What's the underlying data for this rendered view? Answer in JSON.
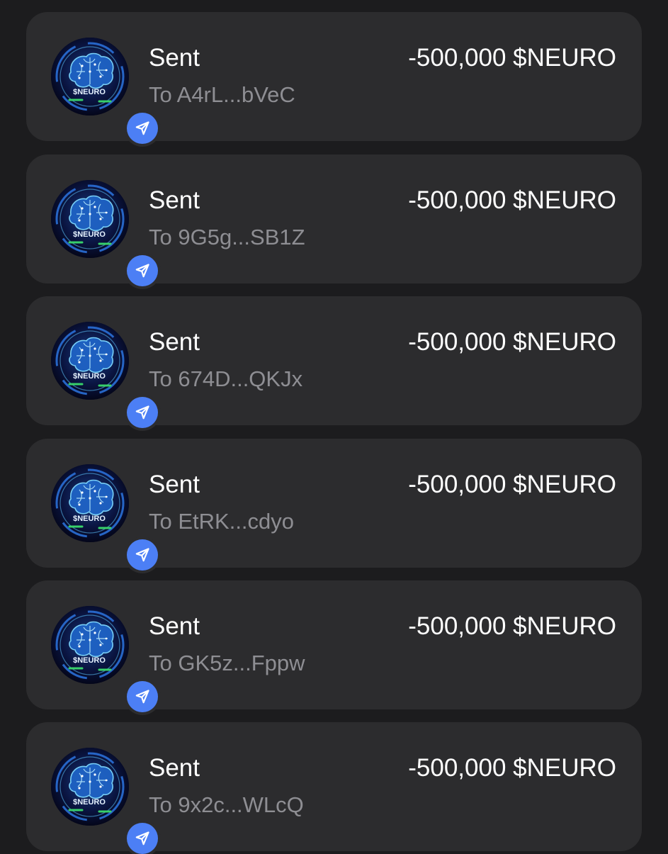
{
  "colors": {
    "background": "#1c1c1e",
    "card": "#2c2c2e",
    "primary_text": "#ffffff",
    "secondary_text": "#8e8e93",
    "send_badge": "#4c7ff5"
  },
  "token": {
    "logo_text": "$NEURO",
    "icon": "neuro-brain-logo-icon",
    "badge_icon": "send-arrow-icon"
  },
  "transactions": [
    {
      "type": "Sent",
      "recipient": "To A4rL...bVeC",
      "amount": "-500,000 $NEURO"
    },
    {
      "type": "Sent",
      "recipient": "To 9G5g...SB1Z",
      "amount": "-500,000 $NEURO"
    },
    {
      "type": "Sent",
      "recipient": "To 674D...QKJx",
      "amount": "-500,000 $NEURO"
    },
    {
      "type": "Sent",
      "recipient": "To EtRK...cdyo",
      "amount": "-500,000 $NEURO"
    },
    {
      "type": "Sent",
      "recipient": "To GK5z...Fppw",
      "amount": "-500,000 $NEURO"
    },
    {
      "type": "Sent",
      "recipient": "To 9x2c...WLcQ",
      "amount": "-500,000 $NEURO"
    }
  ]
}
